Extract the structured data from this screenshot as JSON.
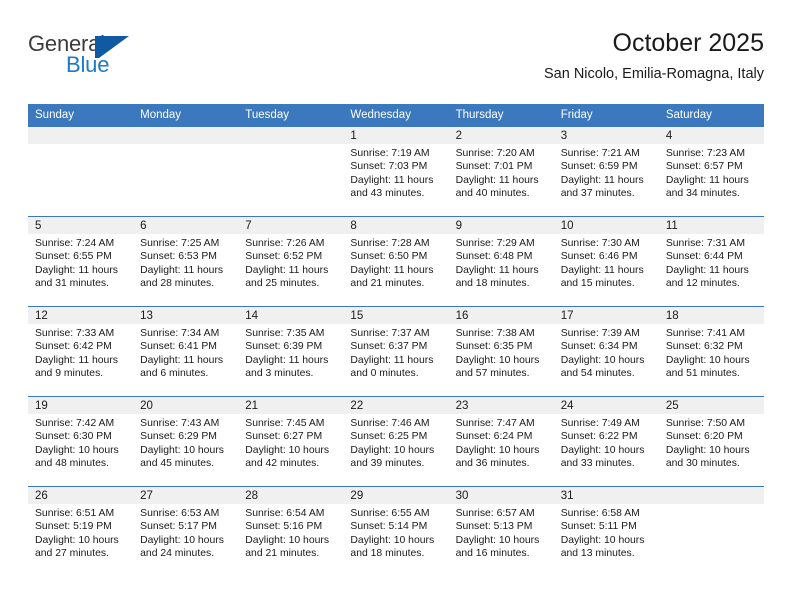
{
  "brand": {
    "word1": "General",
    "word2": "Blue",
    "mark": "triangle-flag-logo"
  },
  "header": {
    "title": "October 2025",
    "subtitle": "San Nicolo, Emilia-Romagna, Italy"
  },
  "colors": {
    "header_blue": "#3b78bd",
    "brand_blue": "#1b7bc4",
    "mark_blue": "#1259a3",
    "daynum_band": "#f0f0f0",
    "text": "#1a1a1a"
  },
  "weekdays": [
    "Sunday",
    "Monday",
    "Tuesday",
    "Wednesday",
    "Thursday",
    "Friday",
    "Saturday"
  ],
  "weeks": [
    [
      {
        "day": "",
        "sunrise": "",
        "sunset": "",
        "daylight1": "",
        "daylight2": "",
        "empty": true
      },
      {
        "day": "",
        "sunrise": "",
        "sunset": "",
        "daylight1": "",
        "daylight2": "",
        "empty": true
      },
      {
        "day": "",
        "sunrise": "",
        "sunset": "",
        "daylight1": "",
        "daylight2": "",
        "empty": true
      },
      {
        "day": "1",
        "sunrise": "Sunrise: 7:19 AM",
        "sunset": "Sunset: 7:03 PM",
        "daylight1": "Daylight: 11 hours",
        "daylight2": "and 43 minutes."
      },
      {
        "day": "2",
        "sunrise": "Sunrise: 7:20 AM",
        "sunset": "Sunset: 7:01 PM",
        "daylight1": "Daylight: 11 hours",
        "daylight2": "and 40 minutes."
      },
      {
        "day": "3",
        "sunrise": "Sunrise: 7:21 AM",
        "sunset": "Sunset: 6:59 PM",
        "daylight1": "Daylight: 11 hours",
        "daylight2": "and 37 minutes."
      },
      {
        "day": "4",
        "sunrise": "Sunrise: 7:23 AM",
        "sunset": "Sunset: 6:57 PM",
        "daylight1": "Daylight: 11 hours",
        "daylight2": "and 34 minutes."
      }
    ],
    [
      {
        "day": "5",
        "sunrise": "Sunrise: 7:24 AM",
        "sunset": "Sunset: 6:55 PM",
        "daylight1": "Daylight: 11 hours",
        "daylight2": "and 31 minutes."
      },
      {
        "day": "6",
        "sunrise": "Sunrise: 7:25 AM",
        "sunset": "Sunset: 6:53 PM",
        "daylight1": "Daylight: 11 hours",
        "daylight2": "and 28 minutes."
      },
      {
        "day": "7",
        "sunrise": "Sunrise: 7:26 AM",
        "sunset": "Sunset: 6:52 PM",
        "daylight1": "Daylight: 11 hours",
        "daylight2": "and 25 minutes."
      },
      {
        "day": "8",
        "sunrise": "Sunrise: 7:28 AM",
        "sunset": "Sunset: 6:50 PM",
        "daylight1": "Daylight: 11 hours",
        "daylight2": "and 21 minutes."
      },
      {
        "day": "9",
        "sunrise": "Sunrise: 7:29 AM",
        "sunset": "Sunset: 6:48 PM",
        "daylight1": "Daylight: 11 hours",
        "daylight2": "and 18 minutes."
      },
      {
        "day": "10",
        "sunrise": "Sunrise: 7:30 AM",
        "sunset": "Sunset: 6:46 PM",
        "daylight1": "Daylight: 11 hours",
        "daylight2": "and 15 minutes."
      },
      {
        "day": "11",
        "sunrise": "Sunrise: 7:31 AM",
        "sunset": "Sunset: 6:44 PM",
        "daylight1": "Daylight: 11 hours",
        "daylight2": "and 12 minutes."
      }
    ],
    [
      {
        "day": "12",
        "sunrise": "Sunrise: 7:33 AM",
        "sunset": "Sunset: 6:42 PM",
        "daylight1": "Daylight: 11 hours",
        "daylight2": "and 9 minutes."
      },
      {
        "day": "13",
        "sunrise": "Sunrise: 7:34 AM",
        "sunset": "Sunset: 6:41 PM",
        "daylight1": "Daylight: 11 hours",
        "daylight2": "and 6 minutes."
      },
      {
        "day": "14",
        "sunrise": "Sunrise: 7:35 AM",
        "sunset": "Sunset: 6:39 PM",
        "daylight1": "Daylight: 11 hours",
        "daylight2": "and 3 minutes."
      },
      {
        "day": "15",
        "sunrise": "Sunrise: 7:37 AM",
        "sunset": "Sunset: 6:37 PM",
        "daylight1": "Daylight: 11 hours",
        "daylight2": "and 0 minutes."
      },
      {
        "day": "16",
        "sunrise": "Sunrise: 7:38 AM",
        "sunset": "Sunset: 6:35 PM",
        "daylight1": "Daylight: 10 hours",
        "daylight2": "and 57 minutes."
      },
      {
        "day": "17",
        "sunrise": "Sunrise: 7:39 AM",
        "sunset": "Sunset: 6:34 PM",
        "daylight1": "Daylight: 10 hours",
        "daylight2": "and 54 minutes."
      },
      {
        "day": "18",
        "sunrise": "Sunrise: 7:41 AM",
        "sunset": "Sunset: 6:32 PM",
        "daylight1": "Daylight: 10 hours",
        "daylight2": "and 51 minutes."
      }
    ],
    [
      {
        "day": "19",
        "sunrise": "Sunrise: 7:42 AM",
        "sunset": "Sunset: 6:30 PM",
        "daylight1": "Daylight: 10 hours",
        "daylight2": "and 48 minutes."
      },
      {
        "day": "20",
        "sunrise": "Sunrise: 7:43 AM",
        "sunset": "Sunset: 6:29 PM",
        "daylight1": "Daylight: 10 hours",
        "daylight2": "and 45 minutes."
      },
      {
        "day": "21",
        "sunrise": "Sunrise: 7:45 AM",
        "sunset": "Sunset: 6:27 PM",
        "daylight1": "Daylight: 10 hours",
        "daylight2": "and 42 minutes."
      },
      {
        "day": "22",
        "sunrise": "Sunrise: 7:46 AM",
        "sunset": "Sunset: 6:25 PM",
        "daylight1": "Daylight: 10 hours",
        "daylight2": "and 39 minutes."
      },
      {
        "day": "23",
        "sunrise": "Sunrise: 7:47 AM",
        "sunset": "Sunset: 6:24 PM",
        "daylight1": "Daylight: 10 hours",
        "daylight2": "and 36 minutes."
      },
      {
        "day": "24",
        "sunrise": "Sunrise: 7:49 AM",
        "sunset": "Sunset: 6:22 PM",
        "daylight1": "Daylight: 10 hours",
        "daylight2": "and 33 minutes."
      },
      {
        "day": "25",
        "sunrise": "Sunrise: 7:50 AM",
        "sunset": "Sunset: 6:20 PM",
        "daylight1": "Daylight: 10 hours",
        "daylight2": "and 30 minutes."
      }
    ],
    [
      {
        "day": "26",
        "sunrise": "Sunrise: 6:51 AM",
        "sunset": "Sunset: 5:19 PM",
        "daylight1": "Daylight: 10 hours",
        "daylight2": "and 27 minutes."
      },
      {
        "day": "27",
        "sunrise": "Sunrise: 6:53 AM",
        "sunset": "Sunset: 5:17 PM",
        "daylight1": "Daylight: 10 hours",
        "daylight2": "and 24 minutes."
      },
      {
        "day": "28",
        "sunrise": "Sunrise: 6:54 AM",
        "sunset": "Sunset: 5:16 PM",
        "daylight1": "Daylight: 10 hours",
        "daylight2": "and 21 minutes."
      },
      {
        "day": "29",
        "sunrise": "Sunrise: 6:55 AM",
        "sunset": "Sunset: 5:14 PM",
        "daylight1": "Daylight: 10 hours",
        "daylight2": "and 18 minutes."
      },
      {
        "day": "30",
        "sunrise": "Sunrise: 6:57 AM",
        "sunset": "Sunset: 5:13 PM",
        "daylight1": "Daylight: 10 hours",
        "daylight2": "and 16 minutes."
      },
      {
        "day": "31",
        "sunrise": "Sunrise: 6:58 AM",
        "sunset": "Sunset: 5:11 PM",
        "daylight1": "Daylight: 10 hours",
        "daylight2": "and 13 minutes."
      },
      {
        "day": "",
        "sunrise": "",
        "sunset": "",
        "daylight1": "",
        "daylight2": "",
        "empty": true
      }
    ]
  ]
}
